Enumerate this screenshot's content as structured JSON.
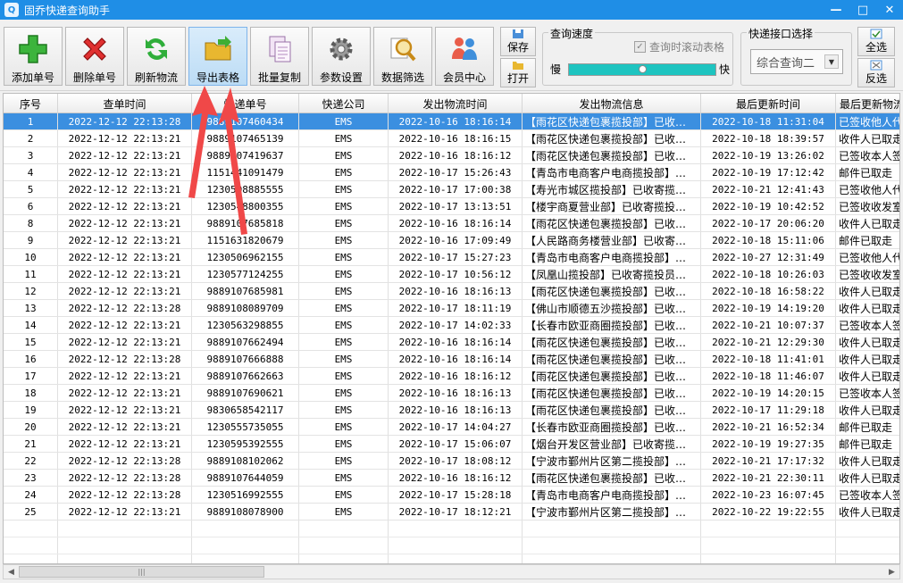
{
  "window": {
    "title": "固乔快递查询助手"
  },
  "toolbar": {
    "buttons": [
      {
        "label": "添加单号",
        "icon": "plus-icon"
      },
      {
        "label": "删除单号",
        "icon": "delete-x-icon"
      },
      {
        "label": "刷新物流",
        "icon": "refresh-icon"
      },
      {
        "label": "导出表格",
        "icon": "export-folder-icon"
      },
      {
        "label": "批量复制",
        "icon": "copy-icon"
      },
      {
        "label": "参数设置",
        "icon": "gear-icon"
      },
      {
        "label": "数据筛选",
        "icon": "magnifier-icon"
      },
      {
        "label": "会员中心",
        "icon": "members-icon"
      }
    ],
    "save_label": "保存",
    "open_label": "打开",
    "speed": {
      "group_label": "查询速度",
      "scroll_label": "查询时滚动表格",
      "slow": "慢",
      "fast": "快",
      "level": 0.5
    },
    "api": {
      "group_label": "快递接口选择",
      "selected": "综合查询二"
    },
    "select_all_label": "全选",
    "invert_label": "反选"
  },
  "grid": {
    "columns": [
      "序号",
      "查单时间",
      "快递单号",
      "快递公司",
      "发出物流时间",
      "发出物流信息",
      "最后更新时间",
      "最后更新物流"
    ],
    "rows": [
      [
        "1",
        "2022-12-12 22:13:28",
        "9889107460434",
        "EMS",
        "2022-10-16 18:16:14",
        "【雨花区快递包裹揽投部】已收…",
        "2022-10-18 11:31:04",
        "已签收他人代"
      ],
      [
        "2",
        "2022-12-12 22:13:21",
        "9889107465139",
        "EMS",
        "2022-10-16 18:16:15",
        "【雨花区快递包裹揽投部】已收…",
        "2022-10-18 18:39:57",
        "收件人已取走"
      ],
      [
        "3",
        "2022-12-12 22:13:21",
        "9889107419637",
        "EMS",
        "2022-10-16 18:16:12",
        "【雨花区快递包裹揽投部】已收…",
        "2022-10-19 13:26:02",
        "已签收本人签"
      ],
      [
        "4",
        "2022-12-12 22:13:21",
        "1151441091479",
        "EMS",
        "2022-10-17 15:26:43",
        "【青岛市电商客户电商揽投部】…",
        "2022-10-19 17:12:42",
        "邮件已取走"
      ],
      [
        "5",
        "2022-12-12 22:13:21",
        "1230508885555",
        "EMS",
        "2022-10-17 17:00:38",
        "【寿光市城区揽投部】已收寄揽…",
        "2022-10-21 12:41:43",
        "已签收他人代"
      ],
      [
        "6",
        "2022-12-12 22:13:21",
        "1230548800355",
        "EMS",
        "2022-10-17 13:13:51",
        "【楼宇商夏营业部】已收寄揽投…",
        "2022-10-19 10:42:52",
        "已签收收发室"
      ],
      [
        "8",
        "2022-12-12 22:13:21",
        "9889107685818",
        "EMS",
        "2022-10-16 18:16:14",
        "【雨花区快递包裹揽投部】已收…",
        "2022-10-17 20:06:20",
        "收件人已取走"
      ],
      [
        "9",
        "2022-12-12 22:13:21",
        "1151631820679",
        "EMS",
        "2022-10-16 17:09:49",
        "【人民路商务楼营业部】已收寄…",
        "2022-10-18 15:11:06",
        "邮件已取走"
      ],
      [
        "10",
        "2022-12-12 22:13:21",
        "1230506962155",
        "EMS",
        "2022-10-17 15:27:23",
        "【青岛市电商客户电商揽投部】…",
        "2022-10-27 12:31:49",
        "已签收他人代"
      ],
      [
        "11",
        "2022-12-12 22:13:21",
        "1230577124255",
        "EMS",
        "2022-10-17 10:56:12",
        "【凤凰山揽投部】已收寄揽投员…",
        "2022-10-18 10:26:03",
        "已签收收发室"
      ],
      [
        "12",
        "2022-12-12 22:13:21",
        "9889107685981",
        "EMS",
        "2022-10-16 18:16:13",
        "【雨花区快递包裹揽投部】已收…",
        "2022-10-18 16:58:22",
        "收件人已取走"
      ],
      [
        "13",
        "2022-12-12 22:13:28",
        "9889108089709",
        "EMS",
        "2022-10-17 18:11:19",
        "【佛山市顺德五沙揽投部】已收…",
        "2022-10-19 14:19:20",
        "收件人已取走"
      ],
      [
        "14",
        "2022-12-12 22:13:21",
        "1230563298855",
        "EMS",
        "2022-10-17 14:02:33",
        "【长春市欧亚商圈揽投部】已收…",
        "2022-10-21 10:07:37",
        "已签收本人签"
      ],
      [
        "15",
        "2022-12-12 22:13:21",
        "9889107662494",
        "EMS",
        "2022-10-16 18:16:14",
        "【雨花区快递包裹揽投部】已收…",
        "2022-10-21 12:29:30",
        "收件人已取走"
      ],
      [
        "16",
        "2022-12-12 22:13:28",
        "9889107666888",
        "EMS",
        "2022-10-16 18:16:14",
        "【雨花区快递包裹揽投部】已收…",
        "2022-10-18 11:41:01",
        "收件人已取走"
      ],
      [
        "17",
        "2022-12-12 22:13:21",
        "9889107662663",
        "EMS",
        "2022-10-16 18:16:12",
        "【雨花区快递包裹揽投部】已收…",
        "2022-10-18 11:46:07",
        "收件人已取走"
      ],
      [
        "18",
        "2022-12-12 22:13:21",
        "9889107690621",
        "EMS",
        "2022-10-16 18:16:13",
        "【雨花区快递包裹揽投部】已收…",
        "2022-10-19 14:20:15",
        "已签收本人签"
      ],
      [
        "19",
        "2022-12-12 22:13:21",
        "9830658542117",
        "EMS",
        "2022-10-16 18:16:13",
        "【雨花区快递包裹揽投部】已收…",
        "2022-10-17 11:29:18",
        "收件人已取走"
      ],
      [
        "20",
        "2022-12-12 22:13:21",
        "1230555735055",
        "EMS",
        "2022-10-17 14:04:27",
        "【长春市欧亚商圈揽投部】已收…",
        "2022-10-21 16:52:34",
        "邮件已取走"
      ],
      [
        "21",
        "2022-12-12 22:13:21",
        "1230595392555",
        "EMS",
        "2022-10-17 15:06:07",
        "【烟台开发区营业部】已收寄揽…",
        "2022-10-19 19:27:35",
        "邮件已取走"
      ],
      [
        "22",
        "2022-12-12 22:13:28",
        "9889108102062",
        "EMS",
        "2022-10-17 18:08:12",
        "【宁波市鄞州片区第二揽投部】…",
        "2022-10-21 17:17:32",
        "收件人已取走"
      ],
      [
        "23",
        "2022-12-12 22:13:28",
        "9889107644059",
        "EMS",
        "2022-10-16 18:16:12",
        "【雨花区快递包裹揽投部】已收…",
        "2022-10-21 22:30:11",
        "收件人已取走"
      ],
      [
        "24",
        "2022-12-12 22:13:28",
        "1230516992555",
        "EMS",
        "2022-10-17 15:28:18",
        "【青岛市电商客户电商揽投部】…",
        "2022-10-23 16:07:45",
        "已签收本人签"
      ],
      [
        "25",
        "2022-12-12 22:13:21",
        "9889108078900",
        "EMS",
        "2022-10-17 18:12:21",
        "【宁波市鄞州片区第二揽投部】…",
        "2022-10-22 19:22:55",
        "收件人已取走"
      ]
    ]
  },
  "colors": {
    "titlebar": "#1f8ee6",
    "selected_row": "#3b8fe0",
    "annotation_arrow": "#f04848"
  }
}
